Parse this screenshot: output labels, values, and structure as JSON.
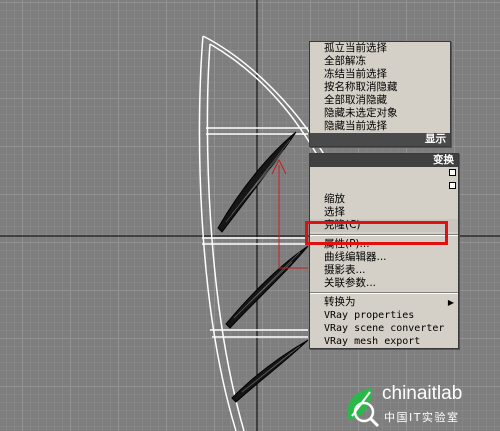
{
  "quad_menu": {
    "display": {
      "header": "显示",
      "items": [
        "孤立当前选择",
        "全部解冻",
        "冻结当前选择",
        "按名称取消隐藏",
        "全部取消隐藏",
        "隐藏未选定对象",
        "隐藏当前选择"
      ]
    },
    "transform": {
      "header": "变换",
      "items": [
        "缩放",
        "选择",
        "克隆(C)",
        "属性(P)...",
        "曲线编辑器...",
        "摄影表...",
        "关联参数...",
        "转换为",
        "VRay properties",
        "VRay scene converter",
        "VRay mesh export"
      ],
      "highlighted_item": "克隆(C)",
      "submenu_item": "转换为"
    }
  },
  "annotation": {
    "color": "#e01010"
  },
  "watermark": {
    "brand": "chinaitlab",
    "subtitle": "中国IT实验室"
  }
}
